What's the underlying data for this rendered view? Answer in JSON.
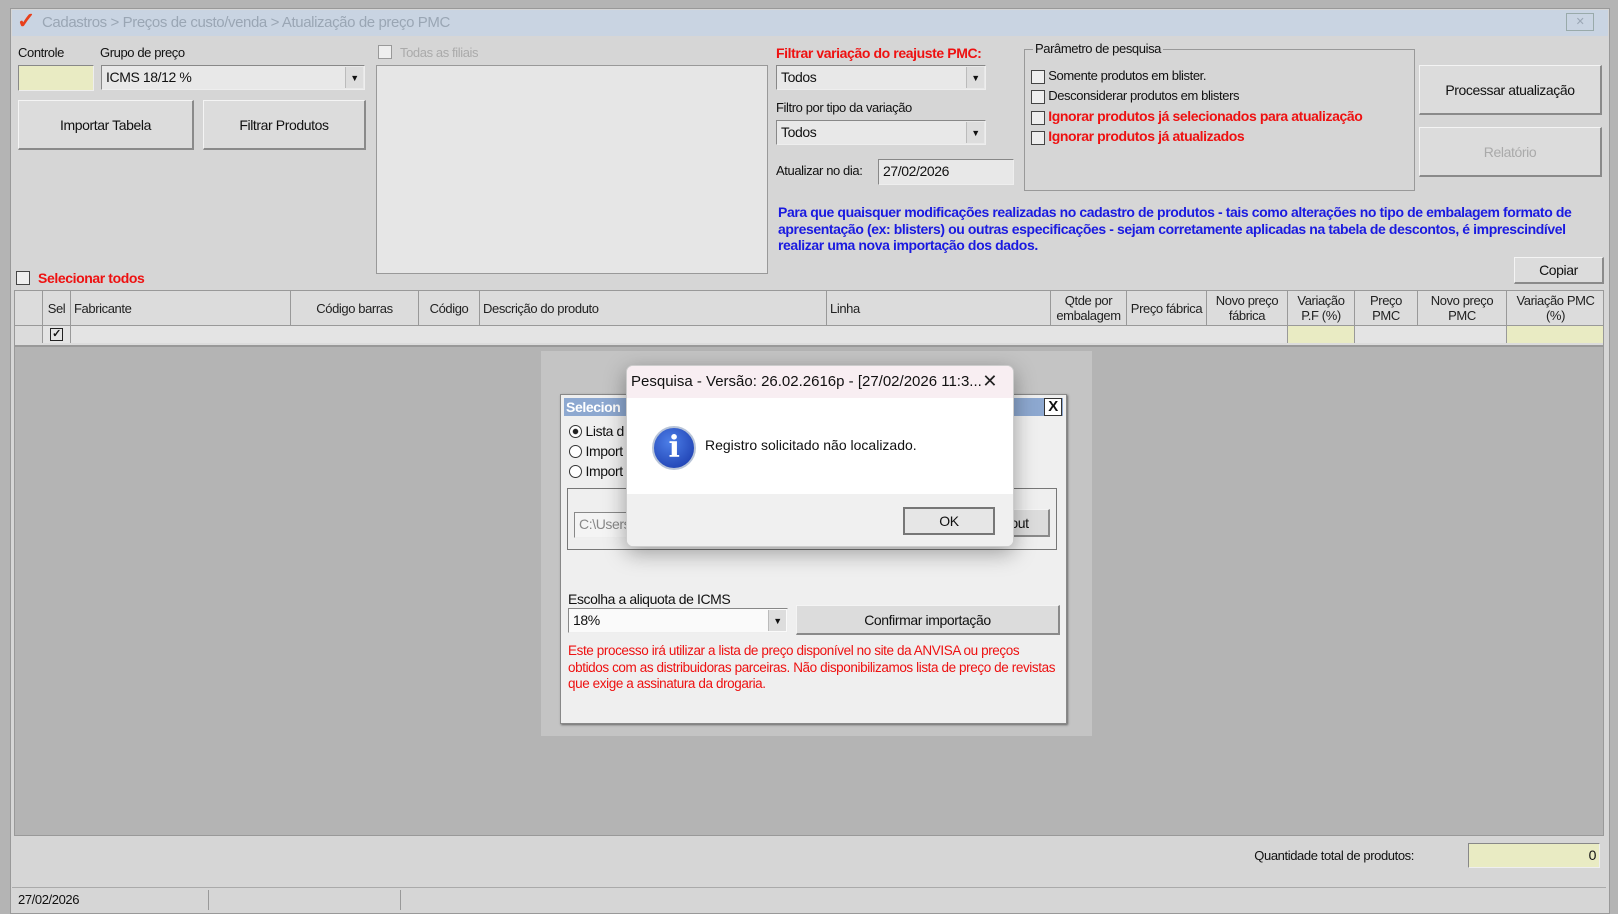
{
  "window": {
    "title": "Cadastros > Preços de custo/venda > Atualização de preço PMC"
  },
  "top": {
    "controle_label": "Controle",
    "controle_value": "",
    "grupo_label": "Grupo de preço",
    "grupo_value": "ICMS 18/12 %",
    "importar_label": "Importar Tabela",
    "filtrar_label": "Filtrar Produtos",
    "todas_filiais_label": "Todas as filiais",
    "selecionar_todos_label": "Selecionar todos"
  },
  "filters": {
    "variacao_label": "Filtrar variação do reajuste PMC:",
    "variacao_value": "Todos",
    "tipo_label": "Filtro por tipo da variação",
    "tipo_value": "Todos",
    "atualizar_label": "Atualizar no dia:",
    "atualizar_value": "27/02/2026"
  },
  "params": {
    "legend": "Parâmetro de pesquisa",
    "options": [
      "Somente produtos em blister.",
      "Desconsiderar produtos em blisters",
      "Ignorar produtos já selecionados para atualização",
      "Ignorar produtos já atualizados"
    ]
  },
  "actions": {
    "processar": "Processar atualização",
    "relatorio": "Relatório",
    "copiar": "Copiar"
  },
  "notice": "Para que quaisquer modificações realizadas no cadastro de produtos - tais como alterações no tipo de embalagem formato de apresentação (ex: blisters) ou outras especificações - sejam corretamente aplicadas na tabela de descontos, é imprescindível realizar uma nova importação dos dados.",
  "table": {
    "columns": [
      "Sel",
      "Fabricante",
      "Código barras",
      "Código",
      "Descrição do produto",
      "Linha",
      "Qtde por embalagem",
      "Preço fábrica",
      "Novo preço fábrica",
      "Variação P.F (%)",
      "Preço PMC",
      "Novo preço PMC",
      "Variação PMC (%)"
    ]
  },
  "footer": {
    "quantidade_label": "Quantidade total de produtos:",
    "quantidade_value": "0",
    "status_date": "27/02/2026"
  },
  "import_dialog": {
    "title": "Selecion",
    "radios": [
      "Lista d",
      "Import",
      "Import"
    ],
    "path_value": "C:\\Users",
    "side_button": "out",
    "icms_label": "Escolha a aliquota de ICMS",
    "icms_value": "18%",
    "confirm": "Confirmar importação",
    "warning": "Este processo irá utilizar a lista de preço disponível no site da ANVISA ou preços obtidos com as distribuidoras parceiras. Não disponibilizamos lista de preço de revistas que exige a assinatura da drogaria.",
    "close": "X"
  },
  "msgbox": {
    "title": "Pesquisa - Versão: 26.02.2616p - [27/02/2026 11:3...",
    "message": "Registro solicitado não localizado.",
    "ok": "OK"
  }
}
